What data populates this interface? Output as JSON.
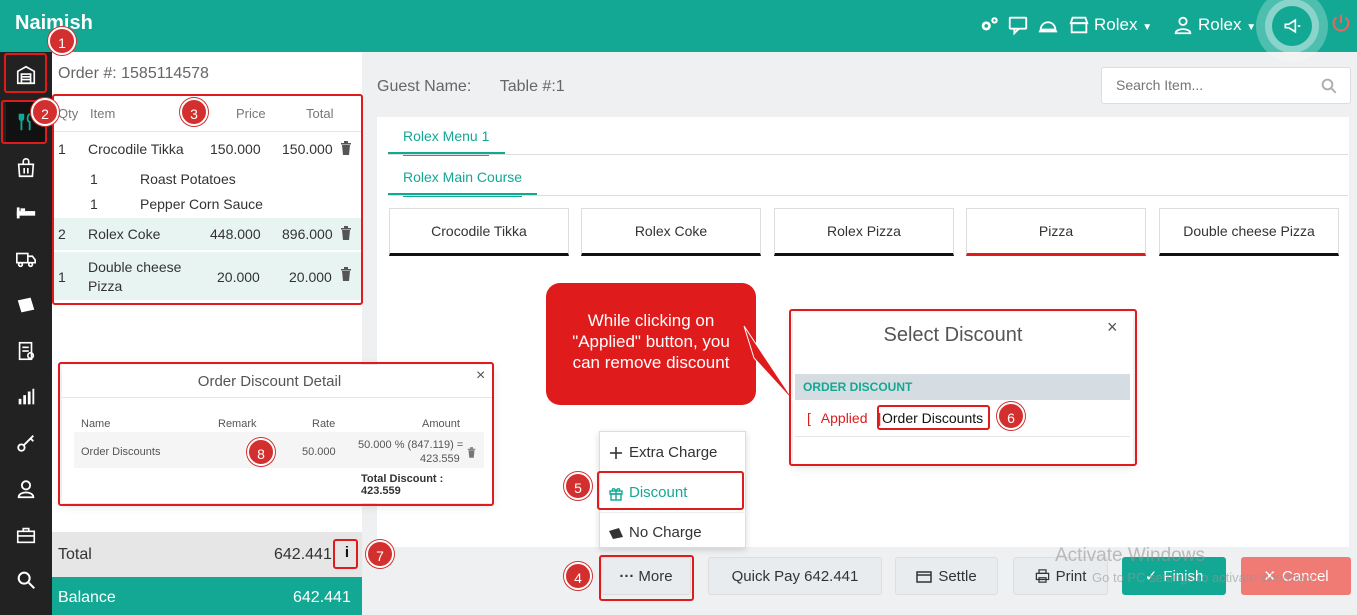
{
  "topbar": {
    "brand": "Naimish",
    "store_label": "Rolex",
    "user_label": "Rolex"
  },
  "order": {
    "number_label": "Order #: 1585114578",
    "headers": {
      "qty": "Qty",
      "item": "Item",
      "price": "Price",
      "total": "Total"
    },
    "rows": [
      {
        "qty": "1",
        "item": "Crocodile Tikka",
        "price": "150.000",
        "total": "150.000"
      },
      {
        "qty": "1",
        "item": "Roast Potatoes",
        "price": "",
        "total": ""
      },
      {
        "qty": "1",
        "item": "Pepper Corn Sauce",
        "price": "",
        "total": ""
      },
      {
        "qty": "2",
        "item": "Rolex Coke",
        "price": "448.000",
        "total": "896.000"
      },
      {
        "qty": "1",
        "item": "Double cheese",
        "item2": "Pizza",
        "price": "20.000",
        "total": "20.000"
      }
    ],
    "total_label": "Total",
    "total_value": "642.441",
    "balance_label": "Balance",
    "balance_value": "642.441"
  },
  "main": {
    "guest_label": "Guest Name:",
    "table_label": "Table #:1",
    "search_placeholder": "Search Item...",
    "tabs": [
      "Rolex Menu 1",
      "Rolex Main Course"
    ],
    "items": [
      "Crocodile Tikka",
      "Rolex Coke",
      "Rolex Pizza",
      "Pizza",
      "Double cheese Pizza"
    ]
  },
  "dropdown": {
    "extra_charge": "Extra Charge",
    "discount": "Discount",
    "no_charge": "No Charge"
  },
  "buttons": {
    "more": "More",
    "quick_pay": "Quick Pay 642.441",
    "settle": "Settle",
    "print": "Print",
    "finish": "Finish",
    "cancel": "Cancel"
  },
  "select_discount": {
    "title": "Select Discount",
    "section": "ORDER DISCOUNT",
    "applied": "Applied",
    "discount_name": "Order Discounts"
  },
  "order_discount_detail": {
    "title": "Order Discount Detail",
    "headers": {
      "name": "Name",
      "remark": "Remark",
      "rate": "Rate",
      "amount": "Amount"
    },
    "row": {
      "name": "Order Discounts",
      "rate": "50.000",
      "amount1": "50.000 % (847.119) =",
      "amount2": "423.559"
    },
    "total": "Total Discount : 423.559"
  },
  "callout": {
    "line1": "While clicking on",
    "line2": "\"Applied\" button, you",
    "line3": "can remove discount"
  },
  "badges": [
    "1",
    "2",
    "3",
    "4",
    "5",
    "6",
    "7",
    "8"
  ],
  "watermark": {
    "line1": "Activate Windows",
    "line2": "Go to PC settings to activate Windows."
  },
  "colors": {
    "accent": "#13a894",
    "annotation": "#e01b1b"
  }
}
